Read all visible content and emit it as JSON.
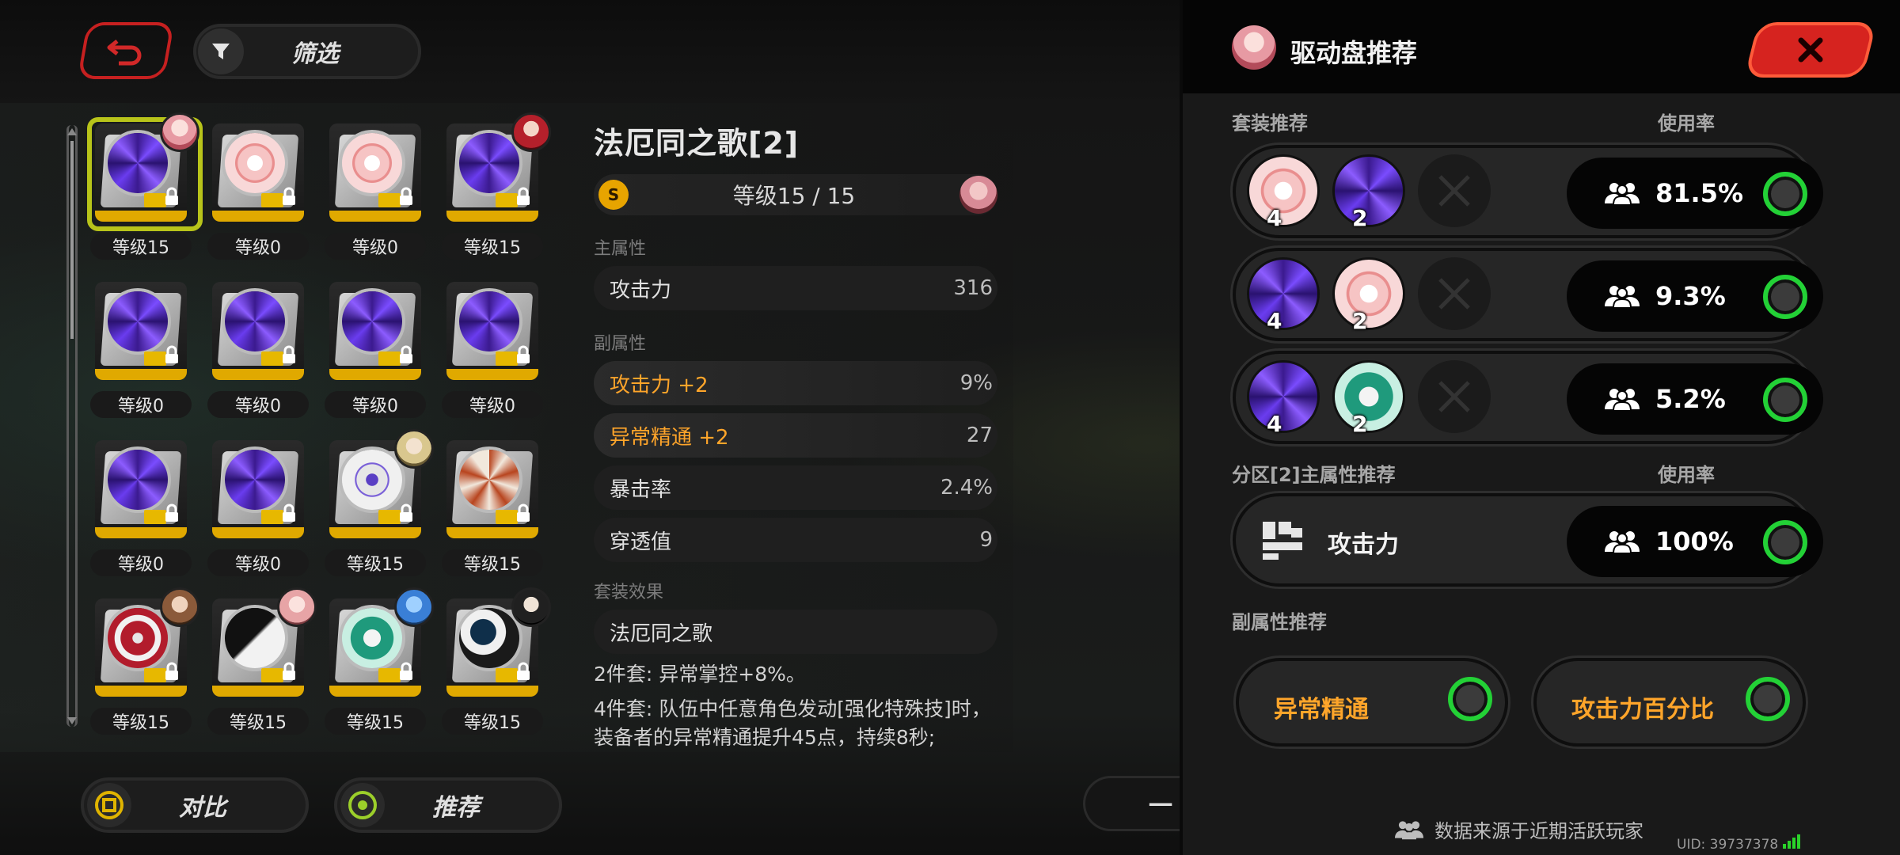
{
  "top": {
    "filter_label": "筛选"
  },
  "discs": [
    {
      "level": "等级15",
      "style": "purple",
      "avatar": "pink",
      "selected": true
    },
    {
      "level": "等级0",
      "style": "pink",
      "avatar": null
    },
    {
      "level": "等级0",
      "style": "pink",
      "avatar": null
    },
    {
      "level": "等级15",
      "style": "purple",
      "avatar": "red"
    },
    {
      "level": "等级0",
      "style": "purple",
      "avatar": null
    },
    {
      "level": "等级0",
      "style": "purple",
      "avatar": null
    },
    {
      "level": "等级0",
      "style": "purple",
      "avatar": null
    },
    {
      "level": "等级0",
      "style": "purple",
      "avatar": null
    },
    {
      "level": "等级0",
      "style": "purple",
      "avatar": null
    },
    {
      "level": "等级0",
      "style": "purple",
      "avatar": null
    },
    {
      "level": "等级15",
      "style": "white-blue",
      "avatar": "blonde"
    },
    {
      "level": "等级15",
      "style": "white-red",
      "avatar": null
    },
    {
      "level": "等级15",
      "style": "red",
      "avatar": "brown"
    },
    {
      "level": "等级15",
      "style": "yinyang",
      "avatar": "pink2"
    },
    {
      "level": "等级15",
      "style": "green",
      "avatar": "blue"
    },
    {
      "level": "等级15",
      "style": "blackwhite",
      "avatar": "dark"
    }
  ],
  "detail": {
    "title": "法厄同之歌[2]",
    "level_icon": "S",
    "level_text": "等级15 / 15",
    "main_label": "主属性",
    "main_stat": {
      "name": "攻击力",
      "value": "316"
    },
    "sub_label": "副属性",
    "sub_stats": [
      {
        "name": "攻击力 +2",
        "value": "9%",
        "highlight": true
      },
      {
        "name": "异常精通 +2",
        "value": "27",
        "highlight": true
      },
      {
        "name": "暴击率",
        "value": "2.4%",
        "highlight": false
      },
      {
        "name": "穿透值",
        "value": "9",
        "highlight": false
      }
    ],
    "set_label": "套装效果",
    "set_name": "法厄同之歌",
    "effect_2": "2件套: 异常掌控+8%。",
    "effect_4": "4件套: 队伍中任意角色发动[强化特殊技]时，装备者的异常精通提升45点，持续8秒;"
  },
  "bottom": {
    "compare_label": "对比",
    "recommend_label": "推荐",
    "partial_label": "一"
  },
  "panel": {
    "title": "驱动盘推荐",
    "set_section": "套装推荐",
    "usage_label": "使用率",
    "sets": [
      {
        "discs": [
          {
            "style": "pink",
            "count": "4"
          },
          {
            "style": "purple",
            "count": "2"
          }
        ],
        "rate": "81.5%"
      },
      {
        "discs": [
          {
            "style": "purple",
            "count": "4"
          },
          {
            "style": "pink",
            "count": "2"
          }
        ],
        "rate": "9.3%"
      },
      {
        "discs": [
          {
            "style": "purple",
            "count": "4"
          },
          {
            "style": "green",
            "count": "2"
          }
        ],
        "rate": "5.2%"
      }
    ],
    "main_section": "分区[2]主属性推荐",
    "main_usage_label": "使用率",
    "main_stat": {
      "name": "攻击力",
      "rate": "100%"
    },
    "sub_section": "副属性推荐",
    "sub_stats": [
      "异常精通",
      "攻击力百分比"
    ],
    "footer": "数据来源于近期活跃玩家",
    "uid": "UID: 39737378"
  },
  "colors": {
    "accent_gold": "#e0a900",
    "highlight_orange": "#ffa52a",
    "check_green": "#23d136",
    "close_red": "#d6231f"
  }
}
